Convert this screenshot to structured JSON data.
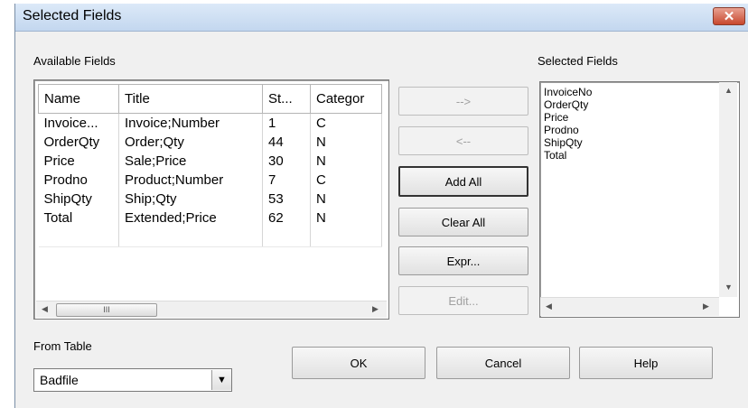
{
  "window": {
    "title": "Selected Fields",
    "close_label": "✕"
  },
  "available": {
    "label": "Available Fields",
    "columns": [
      "Name",
      "Title",
      "St...",
      "Categor"
    ],
    "rows": [
      [
        "Invoice...",
        "Invoice;Number",
        "1",
        "C"
      ],
      [
        "OrderQty",
        "Order;Qty",
        "44",
        "N"
      ],
      [
        "Price",
        "Sale;Price",
        "30",
        "N"
      ],
      [
        "Prodno",
        "Product;Number",
        "7",
        "C"
      ],
      [
        "ShipQty",
        "Ship;Qty",
        "53",
        "N"
      ],
      [
        "Total",
        "Extended;Price",
        "62",
        "N"
      ]
    ],
    "scroll_thumb_label": "III"
  },
  "buttons": {
    "add": "-->",
    "remove": "<--",
    "add_all": "Add All",
    "clear_all": "Clear All",
    "expr": "Expr...",
    "edit": "Edit...",
    "ok": "OK",
    "cancel": "Cancel",
    "help": "Help"
  },
  "selected": {
    "label": "Selected Fields",
    "items": [
      "InvoiceNo",
      "OrderQty",
      "Price",
      "Prodno",
      "ShipQty",
      "Total"
    ]
  },
  "from_table": {
    "label": "From Table",
    "value": "Badfile"
  }
}
